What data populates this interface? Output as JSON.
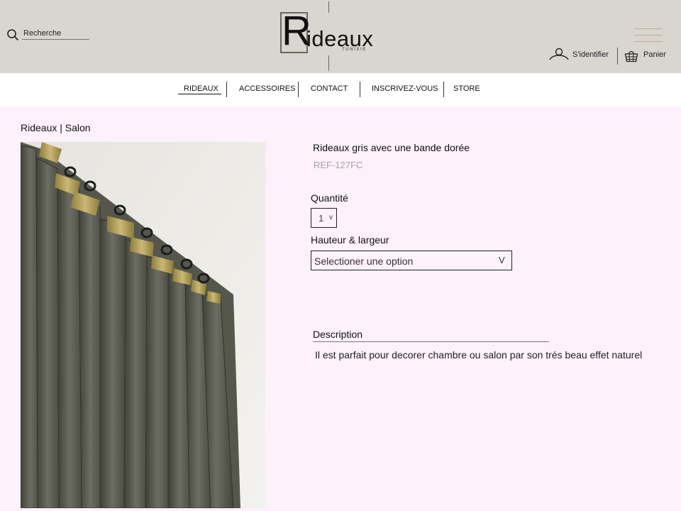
{
  "header": {
    "search": {
      "label": "Recherche",
      "icon": "search-icon"
    },
    "logo": {
      "initial": "R",
      "rest": "ideaux",
      "sub": "TUNISIE"
    },
    "login": {
      "label": "S'identifier",
      "icon": "user-icon"
    },
    "cart": {
      "label": "Panier",
      "icon": "basket-icon"
    },
    "menu_icon": "hamburger-menu-icon"
  },
  "nav": {
    "items": [
      "RIDEAUX",
      "ACCESSOIRES",
      "CONTACT",
      "INSCRIVEZ-VOUS",
      "STORE"
    ],
    "active_index": 0
  },
  "main": {
    "breadcrumb": "Rideaux | Salon",
    "product": {
      "title": "Rideaux gris avec une bande dorée",
      "ref": "REF-127FC",
      "quantity_label": "Quantité",
      "quantity_value": "1",
      "size_label": "Hauteur & largeur",
      "size_placeholder": "Selectioner une option",
      "description_title": "Description",
      "description_text": "Il est parfait pour decorer chambre ou salon par son trés beau effet naturel"
    }
  },
  "colors": {
    "header_bg": "#d9d5cf",
    "page_bg": "#fdf1fb",
    "fabric": "#5f6055",
    "gold_band": "#b8a560"
  }
}
